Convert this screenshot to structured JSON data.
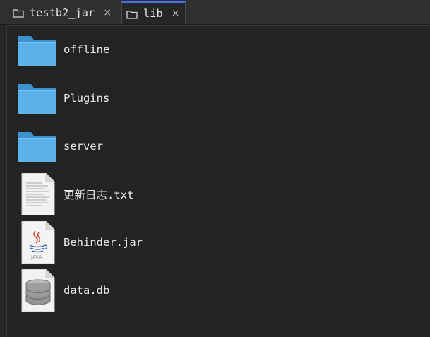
{
  "tabs": [
    {
      "label": "testb2_jar",
      "close": "×"
    },
    {
      "label": "lib",
      "close": "×"
    }
  ],
  "files": [
    {
      "name": "offline",
      "icon": "folder-icon"
    },
    {
      "name": "Plugins",
      "icon": "folder-icon"
    },
    {
      "name": "server",
      "icon": "folder-icon"
    },
    {
      "name": "更新日志.txt",
      "icon": "text-file-icon"
    },
    {
      "name": "Behinder.jar",
      "icon": "java-jar-icon",
      "badge": "JAVA"
    },
    {
      "name": "data.db",
      "icon": "database-file-icon"
    }
  ],
  "colors": {
    "folder": "#5bb3e8",
    "accent": "#4a6ef0",
    "background": "#232323"
  }
}
